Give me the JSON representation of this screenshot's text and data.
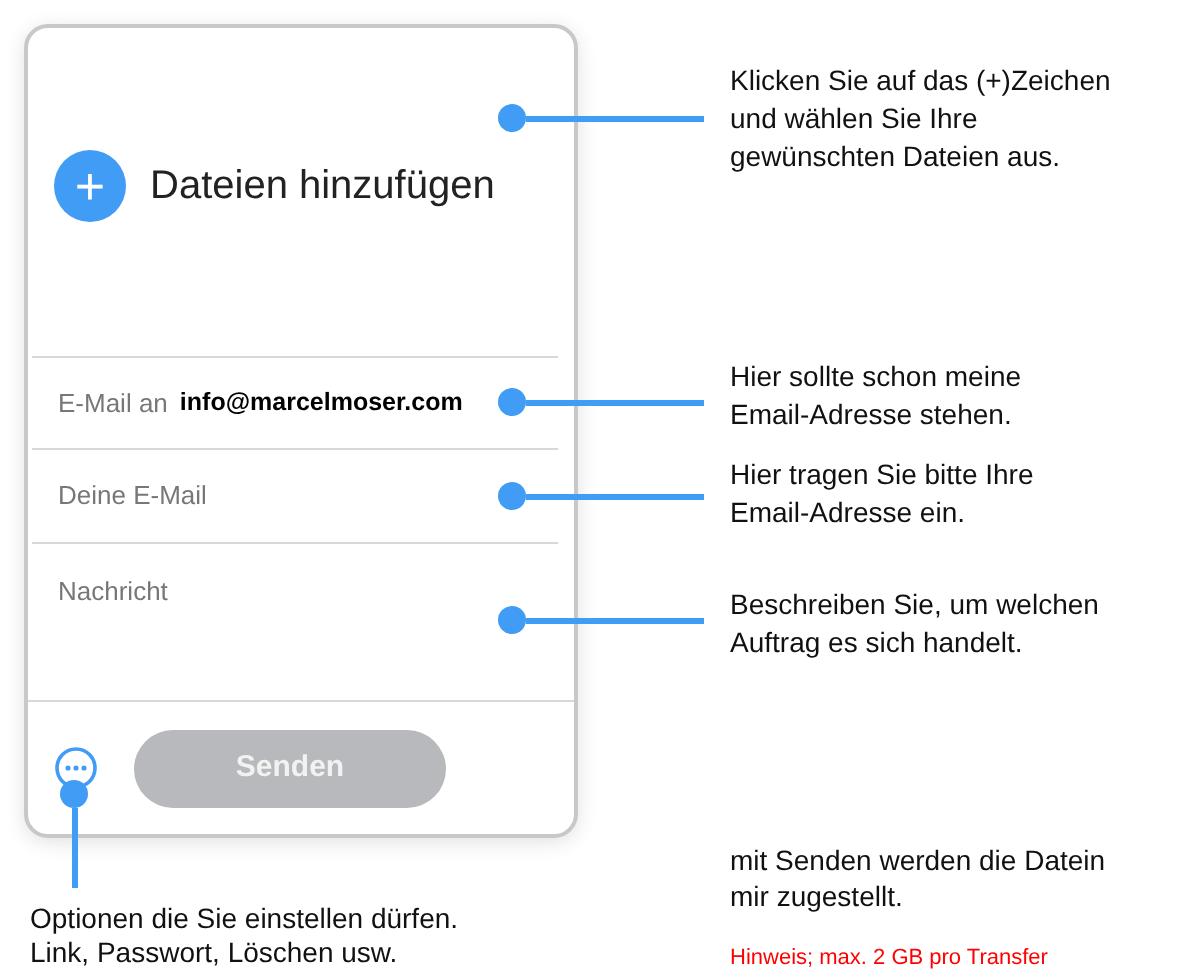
{
  "form": {
    "add_files": {
      "icon": "+",
      "label": "Dateien hinzufügen"
    },
    "recipient": {
      "label": "E-Mail an",
      "value": "info@marcelmoser.com"
    },
    "sender": {
      "placeholder": "Deine E-Mail"
    },
    "message": {
      "placeholder": "Nachricht"
    },
    "send_button": {
      "label": "Senden",
      "disabled": true
    }
  },
  "annotations": [
    {
      "kind": "callout",
      "text": "Klicken Sie auf das (+)Zeichen\nund wählen Sie Ihre\ngewünschten Dateien aus."
    },
    {
      "kind": "callout",
      "text": "Hier sollte schon meine\nEmail-Adresse stehen."
    },
    {
      "kind": "callout",
      "text": "Hier tragen Sie bitte Ihre\nEmail-Adresse ein."
    },
    {
      "kind": "callout",
      "text": "Beschreiben Sie, um welchen\nAuftrag es sich handelt."
    },
    {
      "kind": "options",
      "text": "Optionen die Sie einstellen dürfen.\nLink, Passwort, Löschen usw."
    },
    {
      "kind": "note",
      "text": "mit Senden werden die Datein\nmir zugestellt."
    },
    {
      "kind": "warning",
      "text": "Hinweis; max. 2 GB pro Transfer"
    }
  ]
}
